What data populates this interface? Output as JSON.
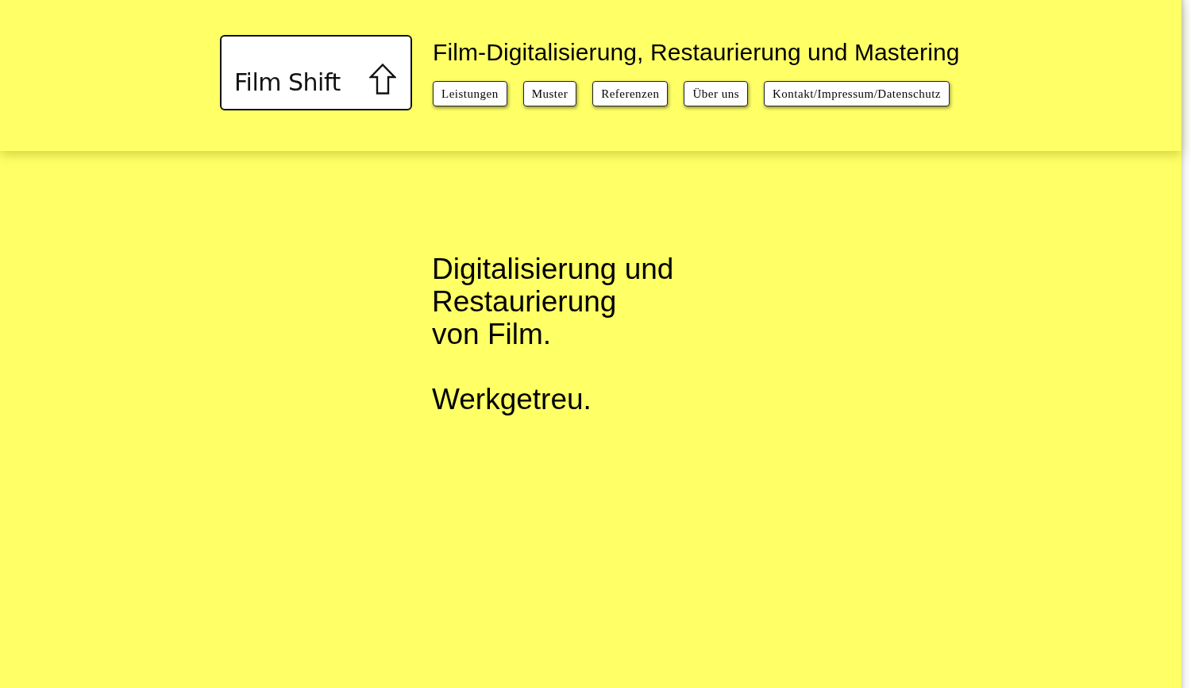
{
  "header": {
    "logo": {
      "text": "Film Shift"
    },
    "title": "Film-Digitalisierung, Restaurierung und Mastering",
    "nav": [
      "Leistungen",
      "Muster",
      "Referenzen",
      "Über uns",
      "Kontakt/Impressum/Datenschutz"
    ]
  },
  "hero": {
    "heading": "Digitalisierung und\nRestaurierung\nvon Film.",
    "tagline": "Werkgetreu."
  }
}
